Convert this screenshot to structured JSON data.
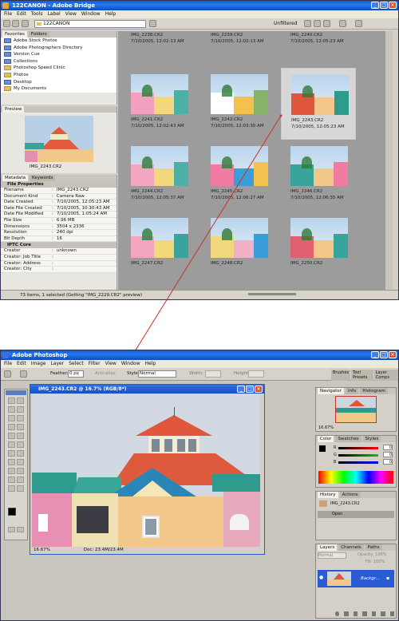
{
  "bridge": {
    "title": "122CANON - Adobe Bridge",
    "menu": [
      "File",
      "Edit",
      "Tools",
      "Label",
      "View",
      "Window",
      "Help"
    ],
    "path": "122CANON",
    "filter": "Unfiltered",
    "favorites_tabs": [
      "Favorites",
      "Folders"
    ],
    "favorites": [
      "Adobe Stock Photos",
      "Adobe Photographers Directory",
      "Version Cue",
      "Collections",
      "Photoshop Speed Clinic",
      "Photos",
      "Desktop",
      "My Documents"
    ],
    "preview_tab": "Preview",
    "preview_label": "IMG_2243.CR2",
    "metadata_tabs": [
      "Metadata",
      "Keywords"
    ],
    "file_properties_title": "File Properties",
    "file_properties": [
      {
        "k": "Filename",
        "v": "IMG_2243.CR2"
      },
      {
        "k": "Document Kind",
        "v": "Camera Raw"
      },
      {
        "k": "Date Created",
        "v": "7/10/2005, 12:05:23 AM"
      },
      {
        "k": "Date File Created",
        "v": "7/10/2005, 10:30:43 AM"
      },
      {
        "k": "Date File Modified",
        "v": "7/10/2005, 1:05:24 AM"
      },
      {
        "k": "File Size",
        "v": "6.96 MB"
      },
      {
        "k": "Dimensions",
        "v": "3504 x 2336"
      },
      {
        "k": "Resolution",
        "v": "240 dpi"
      },
      {
        "k": "Bit Depth",
        "v": "16"
      }
    ],
    "iptc_title": "IPTC Core",
    "iptc": [
      {
        "k": "Creator",
        "v": "unknown"
      },
      {
        "k": "Creator: Job Title",
        "v": ""
      },
      {
        "k": "Creator: Address",
        "v": ""
      },
      {
        "k": "Creator: City",
        "v": ""
      }
    ],
    "thumbnails": [
      {
        "name": "IMG_2238.CR2",
        "date": "7/10/2005, 12:02:13 AM"
      },
      {
        "name": "IMG_2239.CR2",
        "date": "7/10/2005, 12:02:13 AM"
      },
      {
        "name": "IMG_2240.CR2",
        "date": "7/10/2005, 12:05:23 AM"
      },
      {
        "name": "IMG_2241.CR2",
        "date": "7/10/2005, 12:02:43 AM"
      },
      {
        "name": "IMG_2242.CR2",
        "date": "7/10/2005, 12:03:30 AM"
      },
      {
        "name": "IMG_2243.CR2",
        "date": "7/10/2005, 12:05:23 AM"
      },
      {
        "name": "IMG_2244.CR2",
        "date": "7/10/2005, 12:05:37 AM"
      },
      {
        "name": "IMG_2245.CR2",
        "date": "7/10/2005, 12:06:27 AM"
      },
      {
        "name": "IMG_2246.CR2",
        "date": "7/10/2005, 12:06:35 AM"
      },
      {
        "name": "IMG_2247.CR2",
        "date": ""
      },
      {
        "name": "IMG_2248.CR2",
        "date": ""
      },
      {
        "name": "IMG_2250.CR2",
        "date": ""
      }
    ],
    "status": "73 items, 1 selected (Getting \"IMG_2229.CR2\" preview)"
  },
  "photoshop": {
    "title": "Adobe Photoshop",
    "menu": [
      "File",
      "Edit",
      "Image",
      "Layer",
      "Select",
      "Filter",
      "View",
      "Window",
      "Help"
    ],
    "options": {
      "feather_label": "Feather:",
      "feather_value": "0 px",
      "antialias": "Anti-alias",
      "style_label": "Style:",
      "style_value": "Normal",
      "width_label": "Width:",
      "height_label": "Height:"
    },
    "palette_well": [
      "Brushes",
      "Tool Presets",
      "Layer Comps"
    ],
    "doc_title": "IMG_2243.CR2 @ 16.7% (RGB/8*)",
    "doc_zoom": "16.67%",
    "doc_info": "Doc: 23.4M/23.4M",
    "navigator_tabs": [
      "Navigator",
      "Info",
      "Histogram"
    ],
    "navigator_zoom": "16.67%",
    "color_tabs": [
      "Color",
      "Swatches",
      "Styles"
    ],
    "color_labels": [
      "R",
      "G",
      "B"
    ],
    "color_values": [
      "0",
      "0",
      "0"
    ],
    "history_tabs": [
      "History",
      "Actions"
    ],
    "history_items": [
      "IMG_2243.CR2",
      "Open"
    ],
    "layers_tabs": [
      "Layers",
      "Channels",
      "Paths"
    ],
    "layers_mode": "Normal",
    "layers_opacity": "Opacity: 100%",
    "layers_fill": "Fill: 100%",
    "layer_name": "Backgr..."
  },
  "colors": {
    "bridge_bg": "#9c9c9c",
    "accent": "#c8302a",
    "title_blue": "#0a5fd8"
  }
}
